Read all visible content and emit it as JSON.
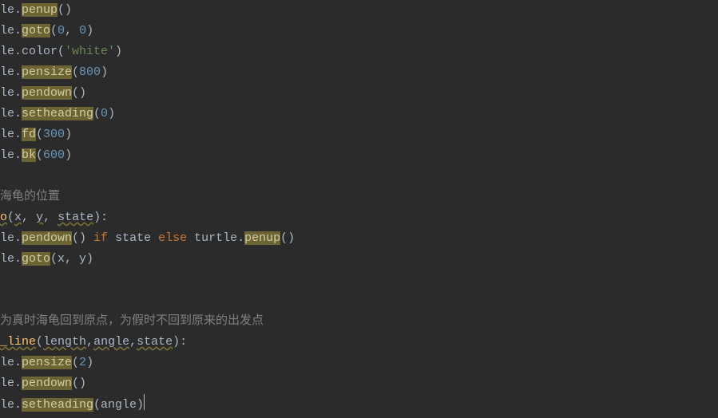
{
  "code": {
    "l1": "le.penup()",
    "l2a": "le.goto(",
    "l2b": "0",
    "l2c": ", ",
    "l2d": "0",
    "l2e": ")",
    "l3a": "le.color(",
    "l3b": "'white'",
    "l3c": ")",
    "l4a": "le.pensize(",
    "l4b": "800",
    "l4c": ")",
    "l5": "le.pendown()",
    "l6a": "le.setheading(",
    "l6b": "0",
    "l6c": ")",
    "l7a": "le.fd(",
    "l7b": "300",
    "l7c": ")",
    "l8a": "le.bk(",
    "l8b": "600",
    "l8c": ")",
    "blank1": "",
    "l10": "海龟的位置",
    "l11a": "o(",
    "l11b": "x",
    "l11c": ", ",
    "l11d": "y",
    "l11e": ", ",
    "l11f": "state",
    "l11g": "):",
    "l12a": "le.pendown() ",
    "l12if": "if",
    "l12sp1": " ",
    "l12state": "state",
    "l12sp2": " ",
    "l12else": "else",
    "l12sp3": " ",
    "l12turtle": "turtle.penup()",
    "l13a": "le.goto(x, y)",
    "blank2": "",
    "blank3": "",
    "l16": "为真时海龟回到原点，为假时不回到原来的出发点",
    "l17a": "_line",
    "l17b": "(",
    "l17c": "length",
    "l17d": ",",
    "l17e": "angle",
    "l17f": ",",
    "l17g": "state",
    "l17h": "):",
    "l18a": "le.pensize(",
    "l18b": "2",
    "l18c": ")",
    "l19": "le.pendown()",
    "l20a": "le.setheading(angle)"
  }
}
